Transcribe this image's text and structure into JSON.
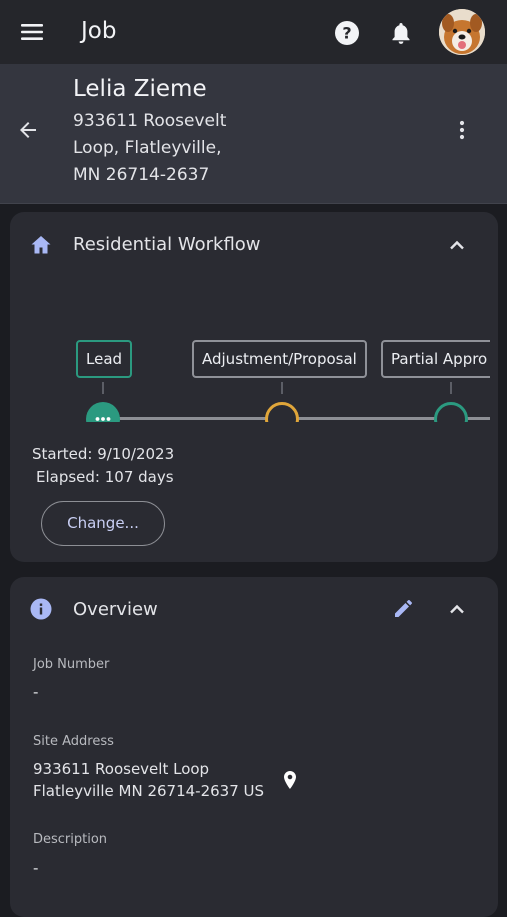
{
  "appbar": {
    "title": "Job",
    "icons": {
      "menu": "menu-icon",
      "help": "help-icon",
      "notifications": "bell-icon",
      "avatar": "dog-avatar"
    }
  },
  "job_header": {
    "customer_name": "Lelia Zieme",
    "address_lines": [
      "933611 Roosevelt",
      "Loop, Flatleyville,",
      "MN 26714-2637"
    ]
  },
  "workflow": {
    "title": "Residential Workflow",
    "stages": [
      {
        "label": "Lead",
        "state": "current",
        "color": "#2b9a80"
      },
      {
        "label": "Adjustment/Proposal",
        "state": "pending",
        "color": "#e0a63a"
      },
      {
        "label": "Partial Appro",
        "state": "pending",
        "color": "#2b9a80"
      }
    ],
    "started": "Started: 9/10/2023",
    "elapsed": "Elapsed: 107 days",
    "change_button": "Change..."
  },
  "overview": {
    "title": "Overview",
    "job_number_label": "Job Number",
    "job_number_value": "-",
    "site_address_label": "Site Address",
    "site_address_line1": "933611 Roosevelt Loop",
    "site_address_line2": "Flatleyville MN 26714-2637 US",
    "description_label": "Description",
    "description_value": "-"
  },
  "colors": {
    "accent_teal": "#2b9a80",
    "accent_amber": "#e0a63a",
    "icon_blue": "#a9b8f5",
    "link": "#c9cff4"
  }
}
